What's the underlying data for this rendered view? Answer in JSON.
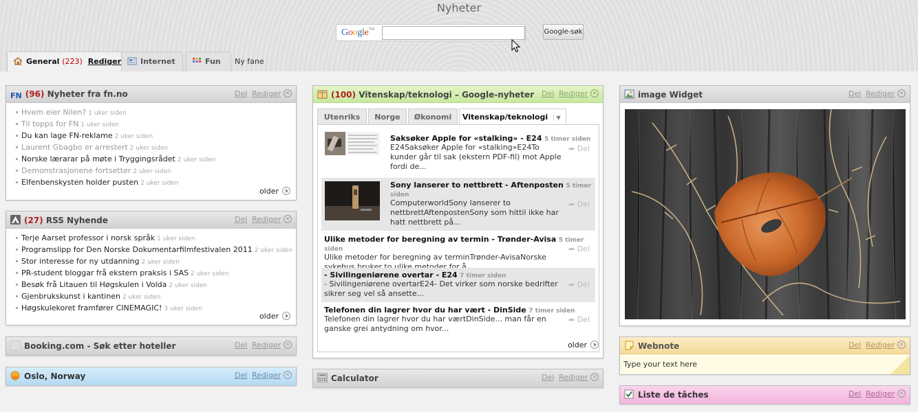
{
  "page": {
    "title": "Nyheter"
  },
  "search": {
    "logo": "Google",
    "logo_tm": "TM",
    "value": "",
    "button": "Google-søk"
  },
  "tabs": [
    {
      "label": "General",
      "count": "(223)",
      "edit": "Rediger",
      "icon": "home-icon"
    },
    {
      "label": "Internet",
      "icon": "internet-icon"
    },
    {
      "label": "Fun",
      "icon": "fun-grid-icon"
    }
  ],
  "new_tab": "Ny fane",
  "controls": {
    "share": "Del",
    "edit": "Rediger"
  },
  "widgets": {
    "fn": {
      "icon_text": "FN",
      "count": "(96)",
      "title": "Nyheter fra fn.no",
      "items": [
        {
          "text": "Hvem eier Nilen?",
          "age": "1 uker siden",
          "read": true
        },
        {
          "text": "Til topps for FN",
          "age": "1 uker siden",
          "read": true
        },
        {
          "text": "Du kan lage FN-reklame",
          "age": "2 uker siden",
          "read": false
        },
        {
          "text": "Laurent Gbagbo er arrestert",
          "age": "2 uker siden",
          "read": true
        },
        {
          "text": "Norske lærarar på møte i Tryggingsrådet",
          "age": "2 uker siden",
          "read": false
        },
        {
          "text": "Demonstrasjonene fortsetter",
          "age": "2 uker siden",
          "read": true
        },
        {
          "text": "Elfenbenskysten holder pusten",
          "age": "2 uker siden",
          "read": false
        }
      ],
      "older": "older"
    },
    "rss": {
      "count": "(27)",
      "title": "RSS Nyhende",
      "items": [
        {
          "text": "Terje Aarset professor i norsk språk",
          "age": "1 uker siden"
        },
        {
          "text": "Programslipp for Den Norske Dokumentarfilmfestivalen 2011",
          "age": "2 uker siden"
        },
        {
          "text": "Stor interesse for ny utdanning",
          "age": "2 uker siden"
        },
        {
          "text": "PR-student bloggar frå ekstern praksis i SAS",
          "age": "2 uker siden"
        },
        {
          "text": "Besøk frå Litauen til Høgskulen i Volda",
          "age": "2 uker siden"
        },
        {
          "text": "Gjenbrukskunst i kantinen",
          "age": "2 uker siden"
        },
        {
          "text": "Høgskulekoret framfører CINEMAGIC!",
          "age": "3 uker siden"
        }
      ],
      "older": "older"
    },
    "booking": {
      "title": "Booking.com - Søk etter hoteller"
    },
    "weather": {
      "title": "Oslo, Norway"
    },
    "gnews": {
      "count": "(100)",
      "title": "Vitenskap/teknologi – Google-nyheter",
      "subtabs": [
        "Utenriks",
        "Norge",
        "Økonomi",
        "Vitenskap/teknologi"
      ],
      "items": [
        {
          "title": "Saksøker Apple for «stalking» - E24",
          "age": "5 timer siden",
          "desc": "E24Saksøker Apple for «stalking»E24To kunder går til sak (ekstern PDF-fil) mot Apple fordi de..."
        },
        {
          "title": "Sony lanserer to nettbrett - Aftenposten",
          "age": "5 timer siden",
          "desc": "ComputerworldSony lanserer to nettbrettAftenpostenSony som hittil ikke har hatt nettbrett på..."
        },
        {
          "title": "Ulike metoder for beregning av termin - Trønder-Avisa",
          "age": "5 timer siden",
          "desc": "Ulike metoder for beregning av terminTrønder-AvisaNorske sykehus bruker to ulike metoder for å..."
        },
        {
          "title": "- Sivilingeniørene overtar - E24",
          "age": "7 timer siden",
          "desc": "- Sivilingeniørene overtarE24- Det virker som norske bedrifter sikrer seg vel så ansette..."
        },
        {
          "title": "Telefonen din lagrer hvor du har vært - DinSide",
          "age": "7 timer siden",
          "desc": "Telefonen din lagrer hvor du har værtDinSide... man får en ganske grei antydning om hvor..."
        }
      ],
      "older": "older"
    },
    "calculator": {
      "title": "Calculator"
    },
    "image": {
      "title": "image Widget"
    },
    "webnote": {
      "title": "Webnote",
      "text": "Type your text here"
    },
    "todo": {
      "title": "Liste de tâches"
    }
  }
}
